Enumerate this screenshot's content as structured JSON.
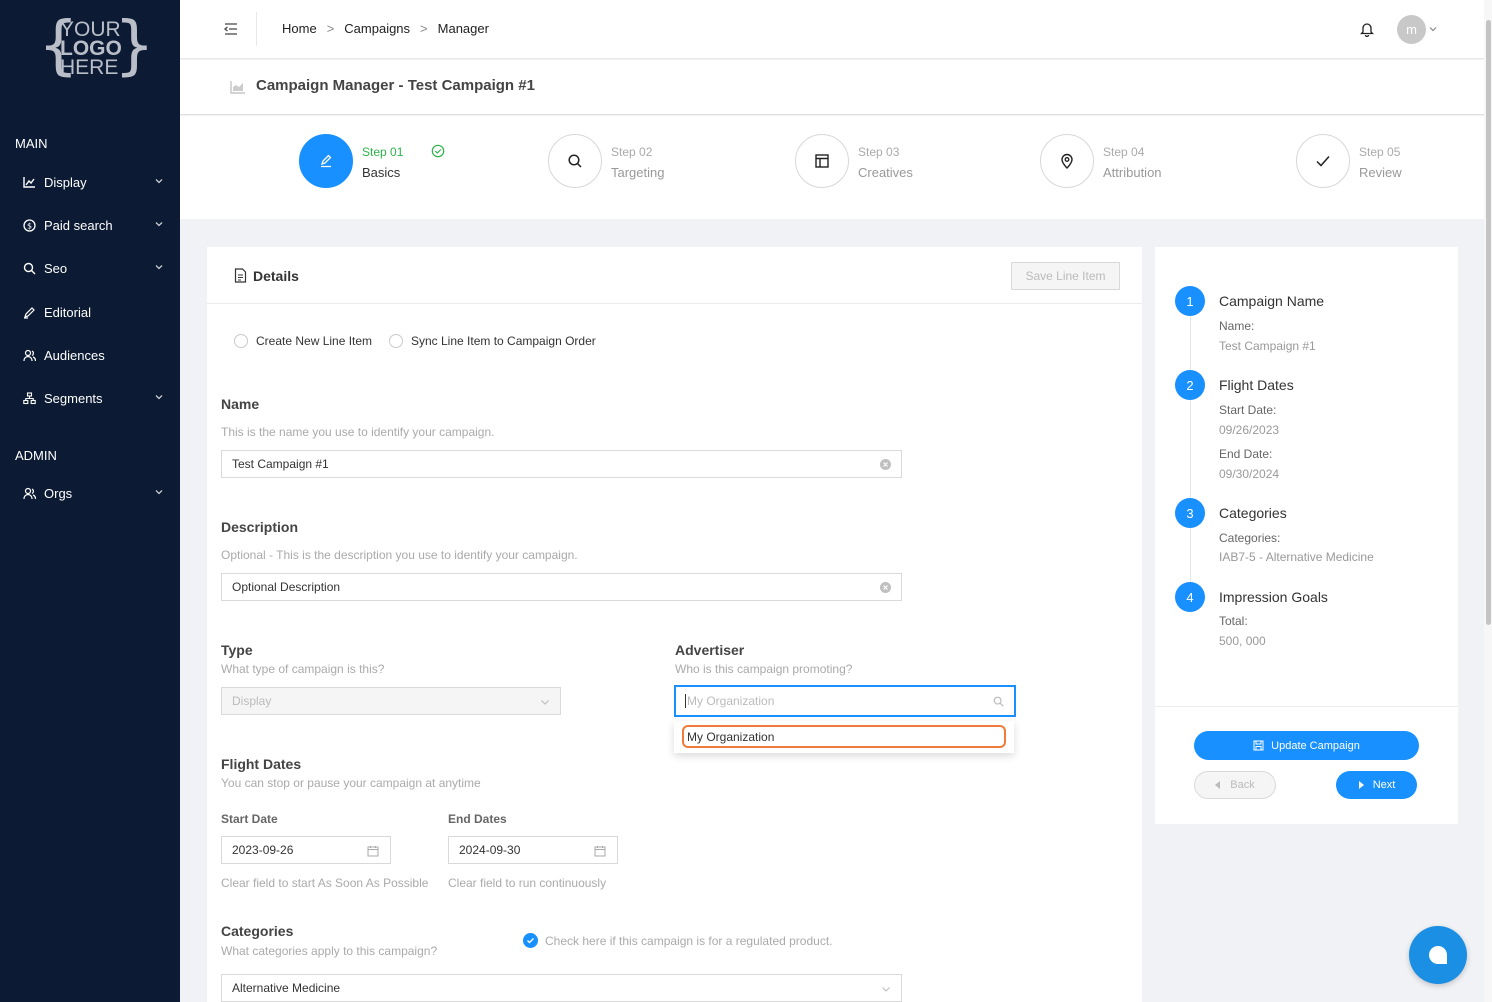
{
  "sidebar": {
    "logo": {
      "line1": "YOUR",
      "line2": "LOGO",
      "line3": "HERE"
    },
    "sections": {
      "main": "MAIN",
      "admin": "ADMIN"
    },
    "items": [
      {
        "label": "Display",
        "icon": "chart-icon",
        "has_children": true
      },
      {
        "label": "Paid search",
        "icon": "dollar-icon",
        "has_children": true
      },
      {
        "label": "Seo",
        "icon": "search-icon",
        "has_children": true
      },
      {
        "label": "Editorial",
        "icon": "pen-icon",
        "has_children": false
      },
      {
        "label": "Audiences",
        "icon": "users-icon",
        "has_children": false
      },
      {
        "label": "Segments",
        "icon": "cluster-icon",
        "has_children": true
      }
    ],
    "admin_items": [
      {
        "label": "Orgs",
        "icon": "users-icon",
        "has_children": true
      }
    ]
  },
  "header": {
    "breadcrumb": [
      "Home",
      "Campaigns",
      "Manager"
    ],
    "user_initial": "m"
  },
  "page": {
    "title": "Campaign Manager - Test Campaign #1"
  },
  "steps": [
    {
      "num": "Step 01",
      "name": "Basics",
      "icon": "edit-icon",
      "active": true,
      "done": true
    },
    {
      "num": "Step 02",
      "name": "Targeting",
      "icon": "search-icon",
      "active": false
    },
    {
      "num": "Step 03",
      "name": "Creatives",
      "icon": "layout-icon",
      "active": false
    },
    {
      "num": "Step 04",
      "name": "Attribution",
      "icon": "location-icon",
      "active": false
    },
    {
      "num": "Step 05",
      "name": "Review",
      "icon": "check-icon",
      "active": false
    }
  ],
  "details": {
    "title": "Details",
    "save_button": "Save Line Item",
    "radio_options": [
      "Create New Line Item",
      "Sync Line Item to Campaign Order"
    ],
    "name": {
      "label": "Name",
      "help": "This is the name you use to identify your campaign.",
      "value": "Test Campaign #1"
    },
    "description": {
      "label": "Description",
      "help": "Optional - This is the description you use to identify your campaign.",
      "value": "Optional Description"
    },
    "type": {
      "label": "Type",
      "help": "What type of campaign is this?",
      "value": "Display"
    },
    "advertiser": {
      "label": "Advertiser",
      "help": "Who is this campaign promoting?",
      "placeholder": "My Organization",
      "options": [
        "My Organization"
      ]
    },
    "flight_dates": {
      "label": "Flight Dates",
      "help": "You can stop or pause your campaign at anytime",
      "start_label": "Start Date",
      "start_value": "2023-09-26",
      "start_help": "Clear field to start As Soon As Possible",
      "end_label": "End Dates",
      "end_value": "2024-09-30",
      "end_help": "Clear field to run continuously"
    },
    "categories": {
      "label": "Categories",
      "help": "What categories apply to this campaign?",
      "regulated_text": "Check here if this campaign is for a regulated product.",
      "value": "Alternative Medicine"
    }
  },
  "summary": {
    "items": [
      {
        "num": "1",
        "title": "Campaign Name",
        "fields": [
          {
            "key": "Name:",
            "value": "Test Campaign #1"
          }
        ]
      },
      {
        "num": "2",
        "title": "Flight Dates",
        "fields": [
          {
            "key": "Start Date:",
            "value": "09/26/2023"
          },
          {
            "key": "End Date:",
            "value": "09/30/2024"
          }
        ]
      },
      {
        "num": "3",
        "title": "Categories",
        "fields": [
          {
            "key": "Categories:",
            "value": "IAB7-5 - Alternative Medicine"
          }
        ]
      },
      {
        "num": "4",
        "title": "Impression Goals",
        "fields": [
          {
            "key": "Total:",
            "value": "500, 000"
          }
        ]
      }
    ],
    "update_button": "Update Campaign",
    "back_button": "Back",
    "next_button": "Next"
  },
  "colors": {
    "primary": "#1890ff",
    "sidebar": "#0c1b33",
    "success": "#2db34a",
    "highlight": "#f07b3a"
  }
}
